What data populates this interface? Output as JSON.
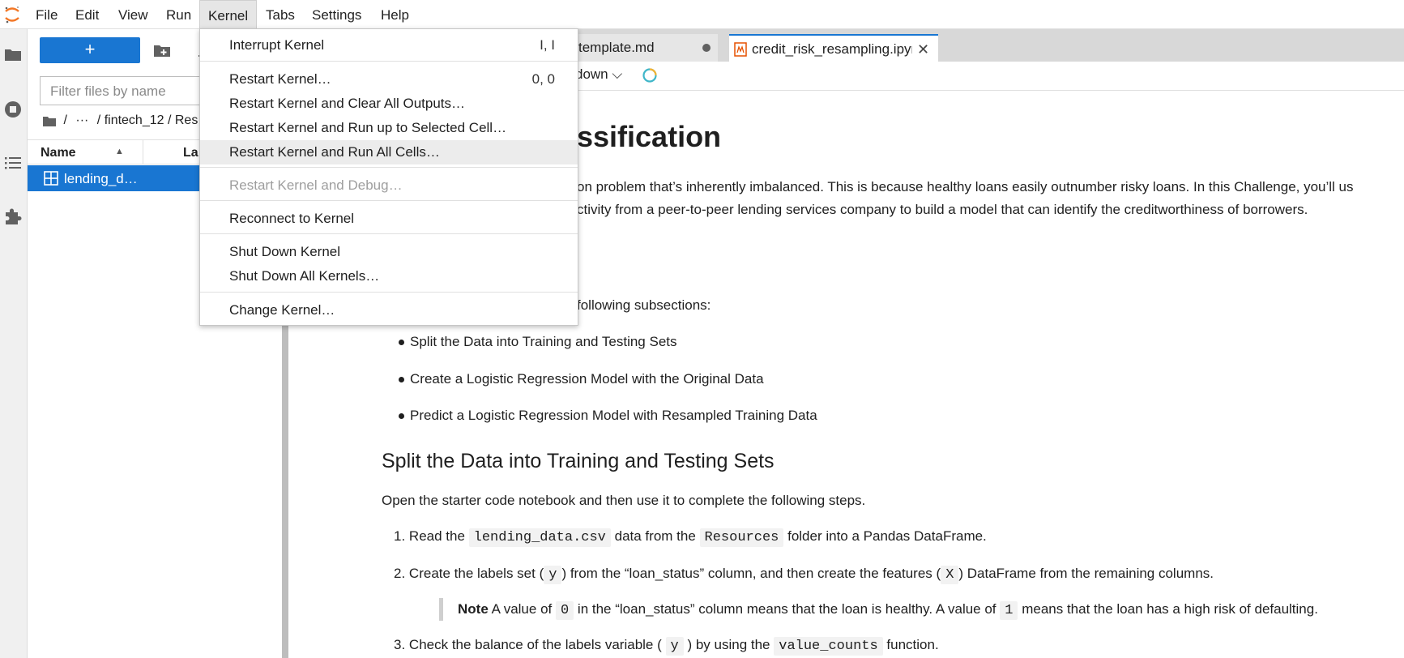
{
  "menubar": {
    "items": [
      "File",
      "Edit",
      "View",
      "Run",
      "Kernel",
      "Tabs",
      "Settings",
      "Help"
    ],
    "active": "Kernel"
  },
  "kernel_menu": {
    "items": [
      {
        "label": "Interrupt Kernel",
        "shortcut": "I, I"
      },
      {
        "label": "Restart Kernel…",
        "shortcut": "0, 0"
      },
      {
        "label": "Restart Kernel and Clear All Outputs…",
        "shortcut": ""
      },
      {
        "label": "Restart Kernel and Run up to Selected Cell…",
        "shortcut": ""
      },
      {
        "label": "Restart Kernel and Run All Cells…",
        "shortcut": "",
        "highlighted": true
      },
      {
        "label": "Restart Kernel and Debug…",
        "shortcut": "",
        "disabled": true
      },
      {
        "label": "Reconnect to Kernel",
        "shortcut": ""
      },
      {
        "label": "Shut Down Kernel",
        "shortcut": ""
      },
      {
        "label": "Shut Down All Kernels…",
        "shortcut": ""
      },
      {
        "label": "Change Kernel…",
        "shortcut": ""
      }
    ]
  },
  "filebrowser": {
    "new_button": "+",
    "filter_placeholder": "Filter files by name",
    "breadcrumb": [
      "/",
      "···",
      "/ fintech_12 / Res"
    ],
    "columns": {
      "name": "Name",
      "last_modified": "La"
    },
    "files": [
      {
        "name": "lending_d…"
      }
    ]
  },
  "tabs": [
    {
      "label": "template.md",
      "modified": true
    },
    {
      "label": "credit_risk_resampling.ipyr",
      "active": true
    }
  ],
  "toolbar": {
    "cell_type": "down ⌵"
  },
  "notebook": {
    "title": "ssification",
    "intro_line1": "on problem that’s inherently imbalanced. This is because healthy loans easily outnumber risky loans. In this Challenge, you’ll us",
    "intro_line2": "ctivity from a peer-to-peer lending services company to build a model that can identify the creditworthiness of borrowers.",
    "subsections_intro": "following subsections:",
    "bullets": [
      "Split the Data into Training and Testing Sets",
      "Create a Logistic Regression Model with the Original Data",
      "Predict a Logistic Regression Model with Resampled Training Data"
    ],
    "section_heading": "Split the Data into Training and Testing Sets",
    "section_intro": "Open the starter code notebook and then use it to complete the following steps.",
    "steps": {
      "s1_num": "1.",
      "s1_a": "Read the",
      "s1_code1": "lending_data.csv",
      "s1_b": "data from the",
      "s1_code2": "Resources",
      "s1_c": "folder into a Pandas DataFrame.",
      "s2_num": "2.",
      "s2_a": "Create the labels set (",
      "s2_code1": "y",
      "s2_b": ") from the “loan_status” column, and then create the features (",
      "s2_code2": "X",
      "s2_c": ") DataFrame from the remaining columns.",
      "note_bold": "Note",
      "note_a": "A value of",
      "note_code1": "0",
      "note_b": "in the “loan_status” column means that the loan is healthy. A value of",
      "note_code2": "1",
      "note_c": "means that the loan has a high risk of defaulting.",
      "s3_num": "3.",
      "s3_a": "Check the balance of the labels variable (",
      "s3_code1": "y",
      "s3_b": ") by using the",
      "s3_code2": "value_counts",
      "s3_c": "function."
    }
  },
  "colors": {
    "accent": "#1976d2",
    "jupyter_orange": "#f37726"
  }
}
